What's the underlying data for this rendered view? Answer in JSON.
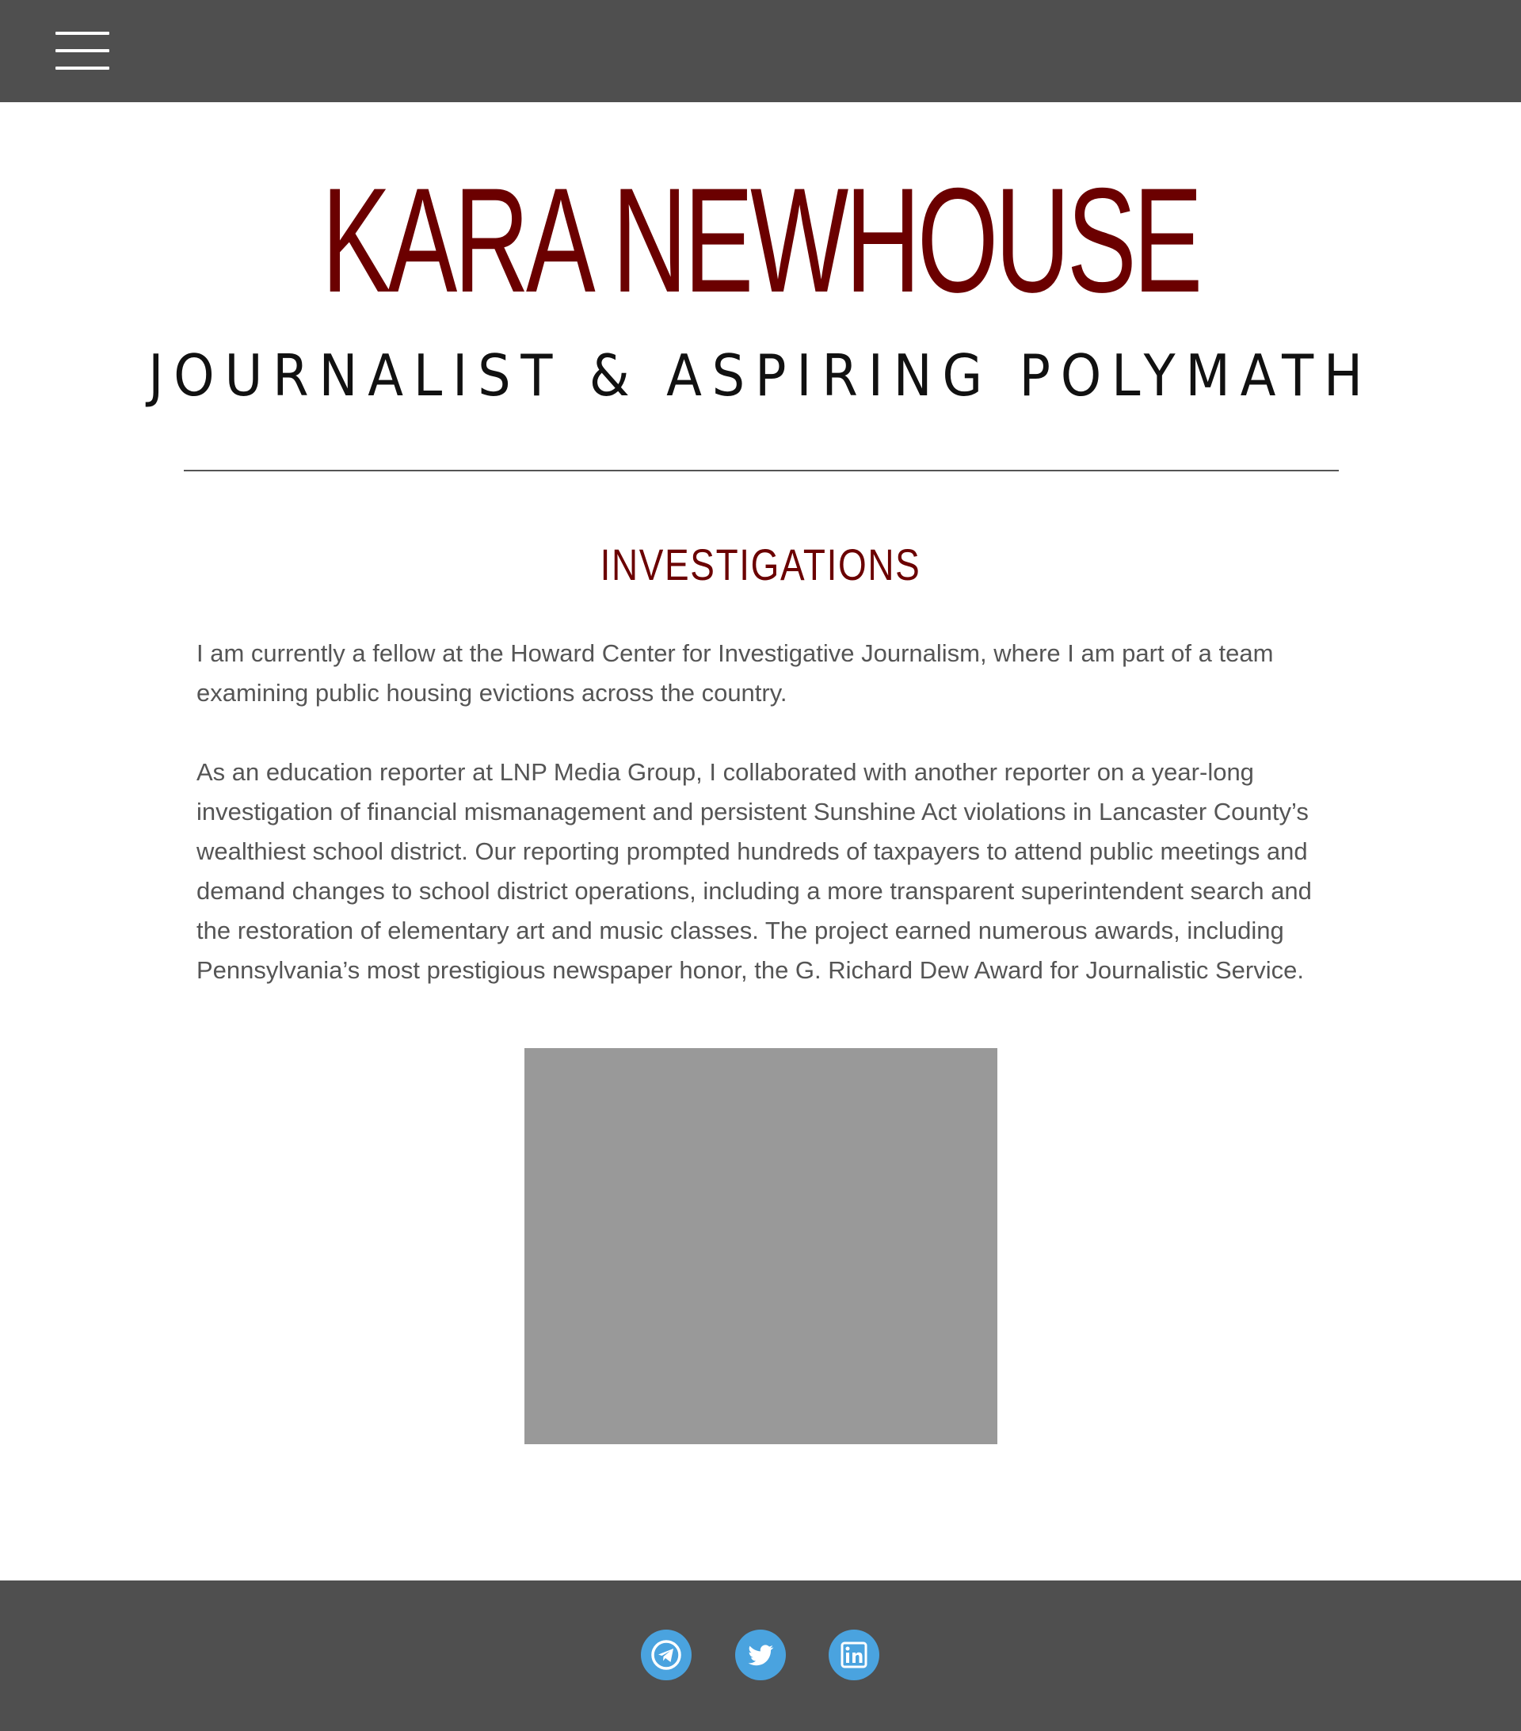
{
  "header": {
    "menu_icon": "hamburger-menu-icon"
  },
  "site": {
    "title": "KARA NEWHOUSE",
    "tagline": "JOURNALIST & ASPIRING POLYMATH"
  },
  "main": {
    "heading": "INVESTIGATIONS",
    "paragraphs": [
      "I am currently a fellow at the Howard Center for Investigative Journalism, where I am part of a team examining public housing evictions across the country.",
      "As an education reporter at LNP Media Group, I collaborated with another reporter on a year-long investigation of financial mismanagement and persistent Sunshine Act violations in Lancaster County’s wealthiest school district. Our reporting prompted hundreds of taxpayers to attend public meetings and demand changes to school district operations, including a more transparent superintendent search and the restoration of elementary art and music classes. The project earned numerous awards, including Pennsylvania’s most prestigious newspaper honor, the G. Richard Dew Award for Journalistic Service."
    ]
  },
  "footer": {
    "social": [
      {
        "icon": "telegram-icon"
      },
      {
        "icon": "twitter-icon"
      },
      {
        "icon": "linkedin-icon"
      }
    ]
  },
  "colors": {
    "header_bg": "#4f4f4f",
    "accent": "#6b0000",
    "body_text": "#555555",
    "social": "#4aa3df",
    "image_placeholder": "#999999"
  }
}
